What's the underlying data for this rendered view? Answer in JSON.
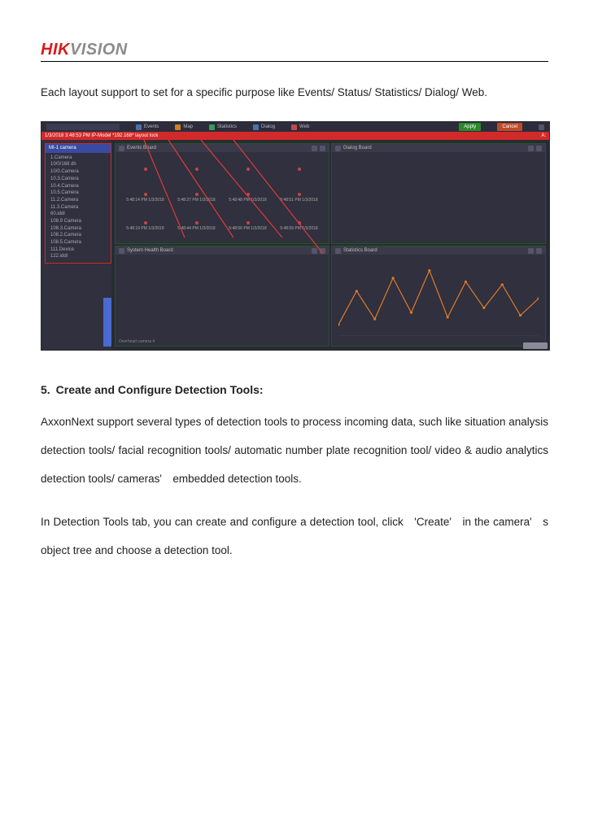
{
  "logo": {
    "part1": "HIK",
    "part2": "VISION"
  },
  "paragraphs": {
    "p1": "Each layout support to set for a specific purpose like Events/ Status/ Statistics/ Dialog/ Web.",
    "p2": "AxxonNext support several types of detection tools to process incoming data, such like situation analysis detection tools/ facial recognition tools/ automatic number plate recognition tool/ video & audio analytics detection tools/ cameras' embedded detection tools.",
    "p3": "In Detection Tools tab, you can create and configure a detection tool, click 'Create' in the camera' s object tree and choose a detection tool."
  },
  "section_heading": "5. Create and Configure Detection Tools:",
  "screenshot": {
    "search_placeholder": "",
    "top_tabs": [
      {
        "label": "Events",
        "color": "blue"
      },
      {
        "label": "Map",
        "color": "orange"
      },
      {
        "label": "Statistics",
        "color": "green"
      },
      {
        "label": "Dialog",
        "color": "blue"
      },
      {
        "label": "Web",
        "color": "red"
      }
    ],
    "apply_label": "Apply",
    "cancel_label": "Cancel",
    "redbar_left": "1/3/2018 3:48:53 PM IP-Model *192.168*   layout lock",
    "redbar_right": "A:",
    "tree_root": "MI-1 camera",
    "tree_items": [
      "1.Camera",
      "10/0/168 dh",
      "10/0.Camera",
      "10.3.Camera",
      "10.4.Camera",
      "10.5.Camera",
      "11.2.Camera",
      "11.3.Camera",
      "60.iddl",
      "108.9 Camera",
      "108.3.Camera",
      "108.2.Camera",
      "108.5.Camera",
      "111.Device",
      "122.iddl"
    ],
    "panels": {
      "events": {
        "title": "Events Board"
      },
      "dialog": {
        "title": "Dialog Board"
      },
      "health": {
        "title": "System Health Board",
        "footer": "Overhead camera 4"
      },
      "stats": {
        "title": "Statistics Board"
      }
    },
    "event_timestamps": [
      "5:48:14 PM 1/3/2018",
      "5:48:27 PM 1/3/2018",
      "5:48:48 PM 1/3/2018",
      "5:48:51 PM 1/3/2018",
      "5:48:19 PM 1/3/2018",
      "5:48:44 PM 1/3/2018",
      "5:48:56 PM 1/3/2018",
      "5:48:59 PM 1/3/2018"
    ],
    "chart_data": {
      "type": "line",
      "x": [
        0,
        1,
        2,
        3,
        4,
        5,
        6,
        7,
        8,
        9,
        10,
        11
      ],
      "values": [
        12,
        48,
        18,
        62,
        25,
        70,
        20,
        58,
        30,
        55,
        22,
        40
      ],
      "ylim": [
        0,
        80
      ],
      "color": "#e07a2a"
    }
  }
}
